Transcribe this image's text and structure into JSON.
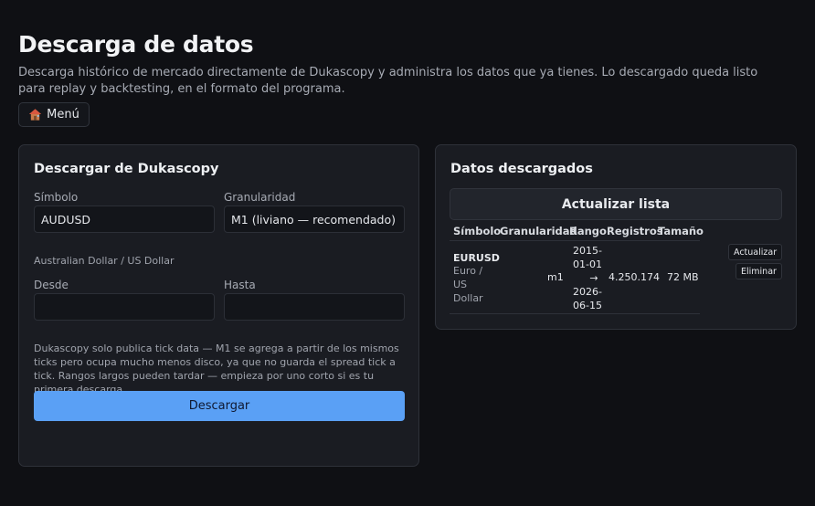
{
  "header": {
    "title": "Descarga de datos",
    "description": "Descarga histórico de mercado directamente de Dukascopy y administra los datos que ya tienes. Lo descargado queda listo para replay y backtesting, en el formato del programa.",
    "menu_label": "Menú",
    "menu_icon": "house-icon"
  },
  "download_panel": {
    "title": "Descargar de Dukascopy",
    "symbol_label": "Símbolo",
    "symbol_value": "AUDUSD",
    "symbol_helper": "Australian Dollar / US Dollar",
    "granularity_label": "Granularidad",
    "granularity_value": "M1 (liviano — recomendado)",
    "from_label": "Desde",
    "from_value": "",
    "to_label": "Hasta",
    "to_value": "",
    "note": "Dukascopy solo publica tick data — M1 se agrega a partir de los mismos ticks pero ocupa mucho menos disco, ya que no guarda el spread tick a tick. Rangos largos pueden tardar — empieza por uno corto si es tu primera descarga.",
    "download_label": "Descargar",
    "accent": "#5aa0f5"
  },
  "downloaded_panel": {
    "title": "Datos descargados",
    "refresh_label": "Actualizar lista",
    "columns": [
      "Símbolo",
      "Granularidad",
      "Rango",
      "Registros",
      "Tamaño"
    ],
    "rows": [
      {
        "symbol": "EURUSD",
        "symbol_desc_1": "Euro /",
        "symbol_desc_2": "US",
        "symbol_desc_3": "Dollar",
        "granularity": "m1",
        "range_1": "2015-",
        "range_2": "01-01",
        "range_arrow": "→",
        "range_3": "2026-",
        "range_4": "06-15",
        "records": "4.250.174",
        "size": "72 MB",
        "update_label": "Actualizar",
        "delete_label": "Eliminar"
      }
    ]
  }
}
